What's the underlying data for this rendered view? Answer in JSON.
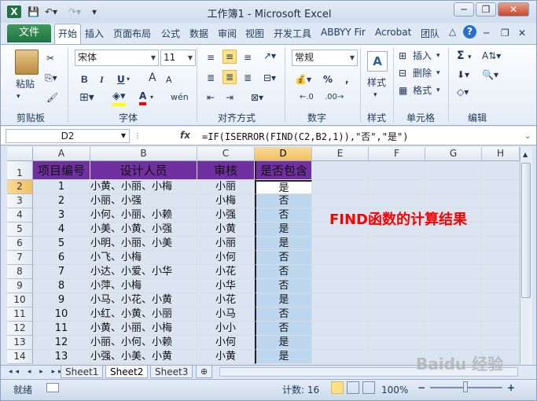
{
  "titlebar": {
    "icon": "X",
    "title": "工作簿1 - Microsoft Excel",
    "min": "─",
    "restore": "❐",
    "close": "✕",
    "inner_min": "─",
    "inner_restore": "❐",
    "inner_close": "✕"
  },
  "tabs": {
    "file": "文件",
    "items": [
      "开始",
      "插入",
      "页面布局",
      "公式",
      "数据",
      "审阅",
      "视图",
      "开发工具",
      "ABBYY Fir",
      "Acrobat",
      "团队"
    ],
    "help": "?"
  },
  "ribbon": {
    "clipboard": {
      "paste": "粘贴",
      "label": "剪贴板"
    },
    "font": {
      "name": "宋体",
      "size": "11",
      "bold": "B",
      "italic": "I",
      "underline": "U",
      "grow": "A",
      "shrink": "A",
      "font_color": "A",
      "wen": "wén",
      "label": "字体"
    },
    "align": {
      "label": "对齐方式"
    },
    "number": {
      "format": "常规",
      "percent": "%",
      "comma": ",",
      "label": "数字"
    },
    "styles": {
      "styles": "样式",
      "label": "样式"
    },
    "cells": {
      "insert": "插入",
      "delete": "删除",
      "format": "格式",
      "label": "单元格"
    },
    "editing": {
      "sum": "Σ",
      "label": "编辑"
    }
  },
  "formula_bar": {
    "name_box": "D2",
    "fx": "fx",
    "formula": "=IF(ISERROR(FIND(C2,B2,1)),\"否\",\"是\")"
  },
  "columns": [
    "A",
    "B",
    "C",
    "D",
    "E",
    "F",
    "G",
    "H"
  ],
  "selected_column": "D",
  "header_row": {
    "row": "1",
    "a": "项目编号",
    "b": "设计人员",
    "c": "审核",
    "d": "是否包含"
  },
  "rows": [
    {
      "row": "2",
      "a": "1",
      "b": "小黄、小丽、小梅",
      "c": "小丽",
      "d": "是"
    },
    {
      "row": "3",
      "a": "2",
      "b": "小丽、小强",
      "c": "小梅",
      "d": "否"
    },
    {
      "row": "4",
      "a": "3",
      "b": "小何、小丽、小赖",
      "c": "小强",
      "d": "否"
    },
    {
      "row": "5",
      "a": "4",
      "b": "小美、小黄、小强",
      "c": "小黄",
      "d": "是"
    },
    {
      "row": "6",
      "a": "5",
      "b": "小明、小丽、小美",
      "c": "小丽",
      "d": "是"
    },
    {
      "row": "7",
      "a": "6",
      "b": "小飞、小梅",
      "c": "小何",
      "d": "否"
    },
    {
      "row": "8",
      "a": "7",
      "b": "小达、小爱、小华",
      "c": "小花",
      "d": "否"
    },
    {
      "row": "9",
      "a": "8",
      "b": "小萍、小梅",
      "c": "小华",
      "d": "否"
    },
    {
      "row": "10",
      "a": "9",
      "b": "小马、小花、小黄",
      "c": "小花",
      "d": "是"
    },
    {
      "row": "11",
      "a": "10",
      "b": "小红、小黄、小丽",
      "c": "小马",
      "d": "否"
    },
    {
      "row": "12",
      "a": "11",
      "b": "小黄、小丽、小梅",
      "c": "小小",
      "d": "否"
    },
    {
      "row": "13",
      "a": "12",
      "b": "小丽、小何、小赖",
      "c": "小何",
      "d": "是"
    },
    {
      "row": "14",
      "a": "13",
      "b": "小强、小美、小黄",
      "c": "小黄",
      "d": "是"
    }
  ],
  "annotation": "FIND函数的计算结果",
  "sheets": [
    "Sheet1",
    "Sheet2",
    "Sheet3"
  ],
  "active_sheet": "Sheet2",
  "status": {
    "ready": "就绪",
    "count": "计数: 16",
    "zoom": "100%",
    "minus": "−",
    "plus": "+"
  },
  "watermark": "Baidu 经验"
}
